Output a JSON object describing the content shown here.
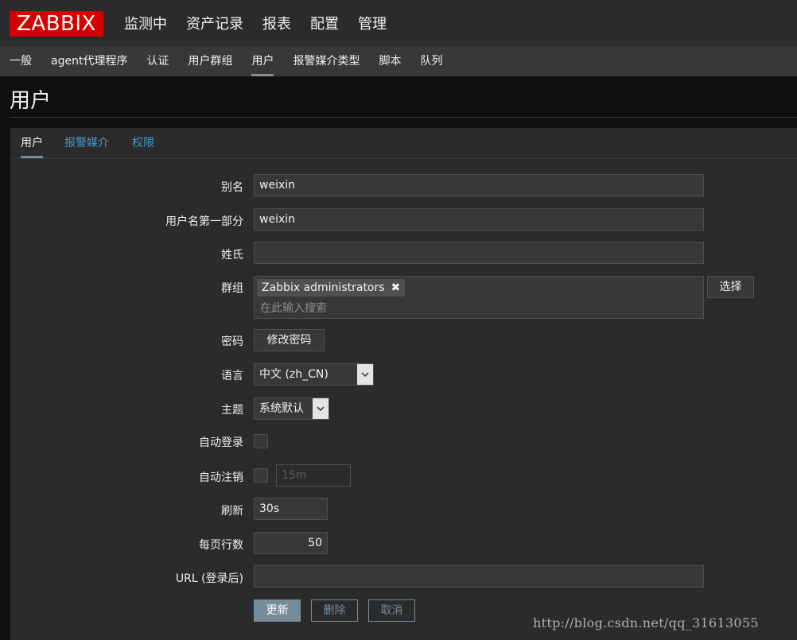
{
  "logo": "ZABBIX",
  "main_menu": [
    "监测中",
    "资产记录",
    "报表",
    "配置",
    "管理"
  ],
  "sub_menu": [
    "一般",
    "agent代理程序",
    "认证",
    "用户群组",
    "用户",
    "报警媒介类型",
    "脚本",
    "队列"
  ],
  "page_title": "用户",
  "tabs": [
    "用户",
    "报警媒介",
    "权限"
  ],
  "form": {
    "alias": {
      "label": "别名",
      "value": "weixin"
    },
    "name": {
      "label": "用户名第一部分",
      "value": "weixin"
    },
    "surname": {
      "label": "姓氏",
      "value": ""
    },
    "groups": {
      "label": "群组",
      "chip": "Zabbix administrators",
      "placeholder": "在此输入搜索",
      "select_btn": "选择"
    },
    "password": {
      "label": "密码",
      "button": "修改密码"
    },
    "language": {
      "label": "语言",
      "value": "中文 (zh_CN)"
    },
    "theme": {
      "label": "主题",
      "value": "系统默认"
    },
    "autologin": {
      "label": "自动登录"
    },
    "autologout": {
      "label": "自动注销",
      "value": "15m"
    },
    "refresh": {
      "label": "刷新",
      "value": "30s"
    },
    "rows_per_page": {
      "label": "每页行数",
      "value": "50"
    },
    "url": {
      "label": "URL (登录后)",
      "value": ""
    }
  },
  "actions": {
    "update": "更新",
    "delete": "删除",
    "cancel": "取消"
  },
  "watermark": "http://blog.csdn.net/qq_31613055"
}
